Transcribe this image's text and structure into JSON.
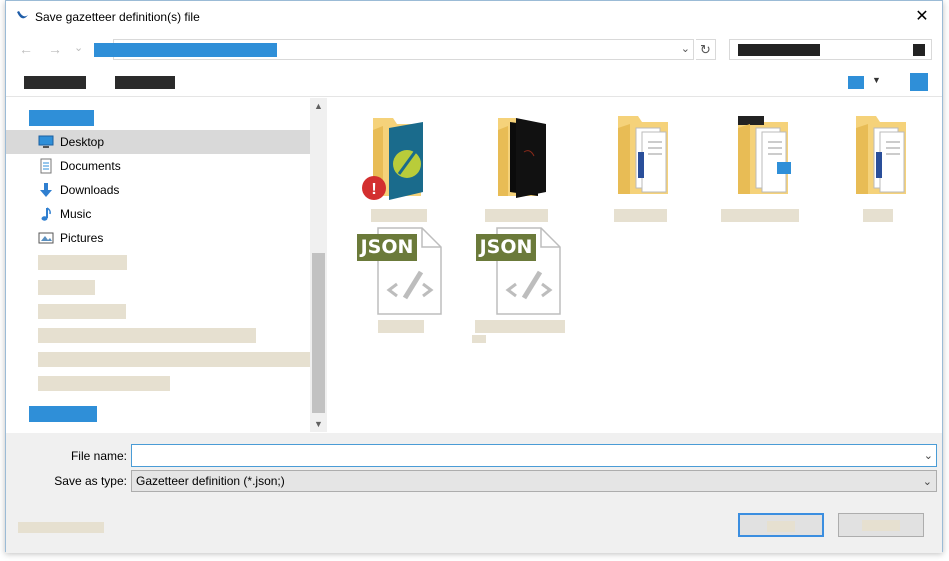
{
  "window": {
    "title": "Save gazetteer definition(s) file",
    "close_glyph": "✕"
  },
  "nav": {
    "back_glyph": "←",
    "forward_glyph": "→",
    "history_glyph": "⌄",
    "refresh_glyph": "↻",
    "dropdown_glyph": "⌄"
  },
  "sidebar": {
    "items": [
      {
        "label": "Desktop",
        "icon": "desktop-icon"
      },
      {
        "label": "Documents",
        "icon": "documents-icon"
      },
      {
        "label": "Downloads",
        "icon": "downloads-icon"
      },
      {
        "label": "Music",
        "icon": "music-icon"
      },
      {
        "label": "Pictures",
        "icon": "pictures-icon"
      }
    ]
  },
  "files": [
    {
      "type": "folder",
      "icon": "folder-app-icon"
    },
    {
      "type": "folder",
      "icon": "folder-dark-icon"
    },
    {
      "type": "folder",
      "icon": "folder-docs-icon"
    },
    {
      "type": "folder",
      "icon": "folder-docs-icon"
    },
    {
      "type": "folder",
      "icon": "folder-docs-icon"
    },
    {
      "type": "json",
      "badge": "JSON",
      "icon": "json-file-icon"
    },
    {
      "type": "json",
      "badge": "JSON",
      "icon": "json-file-icon"
    }
  ],
  "form": {
    "file_name_label": "File name:",
    "file_name_value": "",
    "save_type_label": "Save as type:",
    "save_type_value": "Gazetteer definition (*.json;)"
  },
  "colors": {
    "accent": "#2f8fd8",
    "json_badge": "#6b7a3a",
    "folder": "#f5d27a"
  }
}
